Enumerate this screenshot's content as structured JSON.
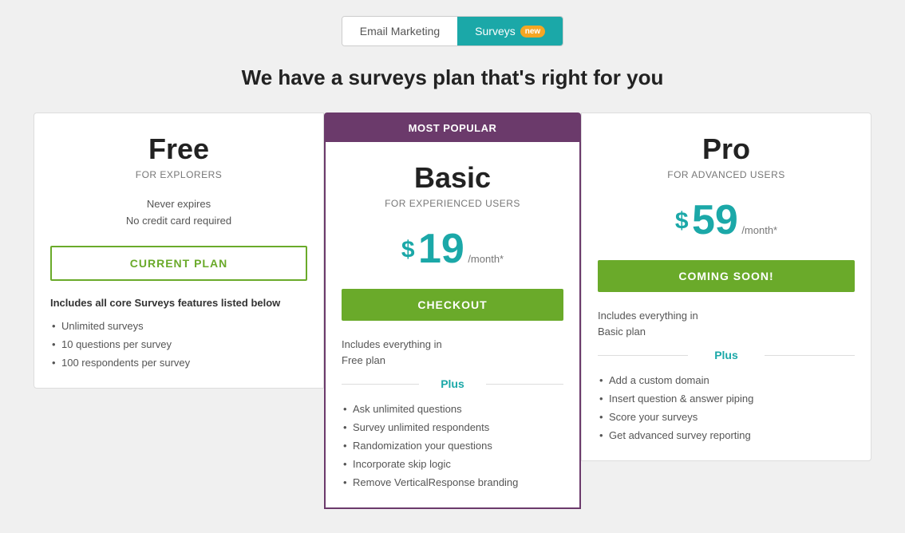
{
  "tabs": {
    "email_marketing": "Email Marketing",
    "surveys": "Surveys",
    "surveys_badge": "new"
  },
  "page_title": "We have a surveys plan that's right for you",
  "plans": [
    {
      "id": "free",
      "name": "Free",
      "subtitle": "FOR EXPLORERS",
      "price": null,
      "price_dollar": null,
      "price_period": null,
      "no_expire_line1": "Never expires",
      "no_expire_line2": "No credit card required",
      "button_label": "CURRENT PLAN",
      "button_type": "current",
      "featured": false,
      "features_header": "Includes all core Surveys features listed below",
      "includes_text": null,
      "plus_label": null,
      "features": [
        "Unlimited surveys",
        "10 questions per survey",
        "100 respondents per survey"
      ]
    },
    {
      "id": "basic",
      "name": "Basic",
      "subtitle": "FOR EXPERIENCED USERS",
      "price": "19",
      "price_dollar": "$",
      "price_period": "/month*",
      "no_expire_line1": null,
      "no_expire_line2": null,
      "button_label": "CHECKOUT",
      "button_type": "checkout",
      "featured": true,
      "most_popular": "MOST POPULAR",
      "features_header": null,
      "includes_text_line1": "Includes everything in",
      "includes_text_line2": "Free plan",
      "plus_label": "Plus",
      "features": [
        "Ask unlimited questions",
        "Survey unlimited respondents",
        "Randomization your questions",
        "Incorporate skip logic",
        "Remove VerticalResponse branding"
      ]
    },
    {
      "id": "pro",
      "name": "Pro",
      "subtitle": "FOR ADVANCED USERS",
      "price": "59",
      "price_dollar": "$",
      "price_period": "/month*",
      "no_expire_line1": null,
      "no_expire_line2": null,
      "button_label": "COMING SOON!",
      "button_type": "coming-soon",
      "featured": false,
      "features_header": null,
      "includes_text_line1": "Includes everything in",
      "includes_text_line2": "Basic plan",
      "plus_label": "Plus",
      "features": [
        "Add a custom domain",
        "Insert question & answer piping",
        "Score your surveys",
        "Get advanced survey reporting"
      ]
    }
  ]
}
